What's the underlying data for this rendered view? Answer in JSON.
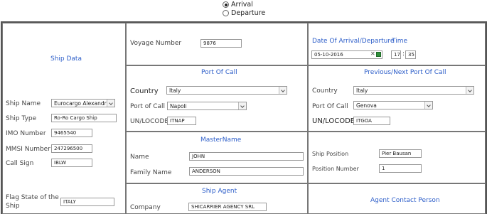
{
  "mode": {
    "arrival_label": "Arrival",
    "departure_label": "Departure"
  },
  "ship_data": {
    "title": "Ship Data",
    "ship_name_label": "Ship Name",
    "ship_name": "Eurocargo Alexandria",
    "ship_type_label": "Ship Type",
    "ship_type": "Ro-Ro Cargo Ship",
    "imo_label": "IMO Number",
    "imo": "9465540",
    "mmsi_label": "MMSI Number",
    "mmsi": "247296500",
    "call_sign_label": "Call Sign",
    "call_sign": "IBLW",
    "flag_label_1": "Flag State of the",
    "flag_label_2": "Ship",
    "flag": "ITALY"
  },
  "voyage": {
    "label": "Voyage Number",
    "value": "9876"
  },
  "datetime": {
    "date_label": "Date Of Arrival/Departure",
    "date": "05-10-2016",
    "time_label": "Time",
    "hour": "17",
    "minute": "35",
    "sep": ":"
  },
  "port_of_call": {
    "title": "Port Of Call",
    "country_label": "Country",
    "country": "Italy",
    "port_label": "Port of Call",
    "port": "Napoli",
    "unlocode_label": "UN/LOCODE",
    "unlocode": "ITNAP"
  },
  "prev_next_port": {
    "title": "Previous/Next Port Of Call",
    "country_label": "Country",
    "country": "Italy",
    "port_label": "Port Of Call",
    "port": "Genova",
    "unlocode_label": "UN/LOCODE",
    "unlocode": "ITGOA"
  },
  "master": {
    "title": "MasterName",
    "name_label": "Name",
    "name": "JOHN",
    "family_label": "Family Name",
    "family": "ANDERSON"
  },
  "position": {
    "ship_position_label": "Ship Position",
    "ship_position": "Pier Bausan",
    "position_number_label": "Position Number",
    "position_number": "1"
  },
  "agent": {
    "title": "Ship Agent",
    "company_label": "Company",
    "company": "SHICARRIER AGENCY SRL"
  },
  "agent_contact": {
    "title": "Agent Contact Person"
  }
}
